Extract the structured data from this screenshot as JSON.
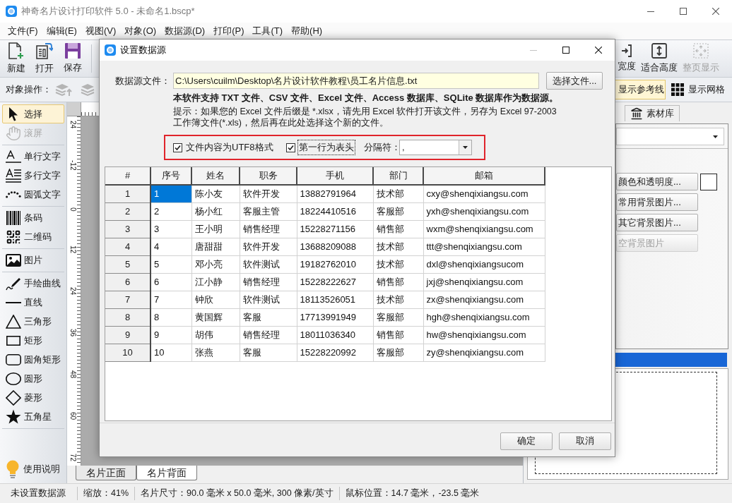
{
  "window": {
    "title": "神奇名片设计打印软件 5.0 - 未命名1.bscp*"
  },
  "menu": [
    "文件(F)",
    "编辑(E)",
    "视图(V)",
    "对象(O)",
    "数据源(D)",
    "打印(P)",
    "工具(T)",
    "帮助(H)"
  ],
  "toolbar": {
    "left": [
      {
        "kind": "new",
        "label": "新建",
        "disabled": false
      },
      {
        "kind": "open",
        "label": "打开",
        "disabled": false
      },
      {
        "kind": "save",
        "label": "保存",
        "disabled": false
      }
    ],
    "right": [
      {
        "kind": "fit_width",
        "label": "宽度",
        "disabled": false
      },
      {
        "kind": "fit_height",
        "label": "适合高度",
        "disabled": false
      },
      {
        "kind": "full_page",
        "label": "整页显示",
        "disabled": true
      }
    ]
  },
  "object_bar": {
    "label": "对象操作：",
    "actions": [
      {
        "kind": "bring_forward",
        "disabled": true
      },
      {
        "kind": "send_backward",
        "disabled": true
      }
    ],
    "toggles": [
      {
        "kind": "guides",
        "label": "显示参考线",
        "selected": true
      },
      {
        "kind": "grid",
        "label": "显示网格",
        "selected": false
      }
    ]
  },
  "tool_groups": [
    {
      "tools": [
        {
          "kind": "select",
          "label": "选择",
          "selected": true,
          "disabled": false
        },
        {
          "kind": "pan",
          "label": "滚屏",
          "selected": false,
          "disabled": true
        }
      ]
    },
    {
      "tools": [
        {
          "kind": "text",
          "label": "单行文字",
          "selected": false,
          "disabled": false
        },
        {
          "kind": "paragraph",
          "label": "多行文字",
          "selected": false,
          "disabled": false
        },
        {
          "kind": "arc_text",
          "label": "圆弧文字",
          "selected": false,
          "disabled": false
        }
      ]
    },
    {
      "tools": [
        {
          "kind": "barcode",
          "label": "条码",
          "selected": false,
          "disabled": false
        },
        {
          "kind": "qrcode",
          "label": "二维码",
          "selected": false,
          "disabled": false
        }
      ]
    },
    {
      "tools": [
        {
          "kind": "image",
          "label": "图片",
          "selected": false,
          "disabled": false
        }
      ]
    },
    {
      "tools": [
        {
          "kind": "freehand",
          "label": "手绘曲线",
          "selected": false,
          "disabled": false
        },
        {
          "kind": "line",
          "label": "直线",
          "selected": false,
          "disabled": false
        },
        {
          "kind": "triangle",
          "label": "三角形",
          "selected": false,
          "disabled": false
        },
        {
          "kind": "rectangle",
          "label": "矩形",
          "selected": false,
          "disabled": false
        },
        {
          "kind": "rounded_rectangle",
          "label": "圆角矩形",
          "selected": false,
          "disabled": false
        },
        {
          "kind": "ellipse",
          "label": "圆形",
          "selected": false,
          "disabled": false
        },
        {
          "kind": "diamond",
          "label": "菱形",
          "selected": false,
          "disabled": false
        },
        {
          "kind": "star",
          "label": "五角星",
          "selected": false,
          "disabled": false
        }
      ]
    }
  ],
  "help": {
    "label": "使用说明"
  },
  "ruler": {
    "labels": [
      "24",
      "-12",
      "0",
      "12",
      "24",
      "36",
      "48",
      "60",
      "72"
    ]
  },
  "page_tabs": [
    {
      "label": "名片正面",
      "selected": true
    },
    {
      "label": "名片背面",
      "selected": false
    }
  ],
  "right_panel": {
    "tabs": [
      {
        "kind": "assets",
        "label": "素材库",
        "selected": false
      }
    ],
    "buttons": [
      {
        "label": "颜色和透明度...",
        "disabled": false
      },
      {
        "label": "常用背景图片...",
        "disabled": false
      },
      {
        "label": "其它背景图片...",
        "disabled": false
      },
      {
        "label": "空背景图片",
        "disabled": true
      }
    ]
  },
  "status_bar": [
    "未设置数据源",
    "缩放：41%",
    "名片尺寸：90.0 毫米 x 50.0 毫米, 300 像素/英寸",
    "鼠标位置：14.7 毫米，-23.5 毫米"
  ],
  "dialog": {
    "title": "设置数据源",
    "controls": [
      {
        "kind": "minimize",
        "disabled": true
      },
      {
        "kind": "maximize",
        "disabled": false
      },
      {
        "kind": "close",
        "disabled": false
      }
    ],
    "file_label": "数据源文件：",
    "file_path": "C:\\Users\\cuilm\\Desktop\\名片设计软件教程\\员工名片信息.txt",
    "browse_button": "选择文件...",
    "support_note": "本软件支持 TXT 文件、CSV 文件、Excel 文件、Access 数据库、SQLite 数据库作为数据源。",
    "hint": "提示：如果您的 Excel 文件后缀是 *.xlsx，请先用 Excel 软件打开该文件，另存为 Excel 97-2003 工作簿文件(*.xls)，然后再在此处选择这个新的文件。",
    "options": [
      {
        "label": "文件内容为UTF8格式",
        "checked": true,
        "focused": false
      },
      {
        "label": "第一行为表头",
        "checked": true,
        "focused": true
      }
    ],
    "separator": {
      "label": "分隔符：",
      "value": ","
    },
    "table": {
      "corner": "#",
      "columns": [
        "序号",
        "姓名",
        "职务",
        "手机",
        "部门",
        "邮箱"
      ],
      "rows": [
        {
          "header": "1",
          "cells": [
            {
              "text": "1",
              "selected": true
            },
            {
              "text": "陈小友",
              "selected": false
            },
            {
              "text": "软件开发",
              "selected": false
            },
            {
              "text": "13882791964",
              "selected": false
            },
            {
              "text": "技术部",
              "selected": false
            },
            {
              "text": "cxy@shenqixiangsu.com",
              "selected": false
            }
          ]
        },
        {
          "header": "2",
          "cells": [
            {
              "text": "2",
              "selected": false
            },
            {
              "text": "杨小红",
              "selected": false
            },
            {
              "text": "客服主管",
              "selected": false
            },
            {
              "text": "18224410516",
              "selected": false
            },
            {
              "text": "客服部",
              "selected": false
            },
            {
              "text": "yxh@shenqixiangsu.com",
              "selected": false
            }
          ]
        },
        {
          "header": "3",
          "cells": [
            {
              "text": "3",
              "selected": false
            },
            {
              "text": "王小明",
              "selected": false
            },
            {
              "text": "销售经理",
              "selected": false
            },
            {
              "text": "15228271156",
              "selected": false
            },
            {
              "text": "销售部",
              "selected": false
            },
            {
              "text": "wxm@shenqixiangsu.com",
              "selected": false
            }
          ]
        },
        {
          "header": "4",
          "cells": [
            {
              "text": "4",
              "selected": false
            },
            {
              "text": "唐甜甜",
              "selected": false
            },
            {
              "text": "软件开发",
              "selected": false
            },
            {
              "text": "13688209088",
              "selected": false
            },
            {
              "text": "技术部",
              "selected": false
            },
            {
              "text": "ttt@shenqixiangsu.com",
              "selected": false
            }
          ]
        },
        {
          "header": "5",
          "cells": [
            {
              "text": "5",
              "selected": false
            },
            {
              "text": "邓小亮",
              "selected": false
            },
            {
              "text": "软件测试",
              "selected": false
            },
            {
              "text": "19182762010",
              "selected": false
            },
            {
              "text": "技术部",
              "selected": false
            },
            {
              "text": "dxl@shenqixiangsucom",
              "selected": false
            }
          ]
        },
        {
          "header": "6",
          "cells": [
            {
              "text": "6",
              "selected": false
            },
            {
              "text": "江小静",
              "selected": false
            },
            {
              "text": "销售经理",
              "selected": false
            },
            {
              "text": "15228222627",
              "selected": false
            },
            {
              "text": "销售部",
              "selected": false
            },
            {
              "text": "jxj@shenqixiangsu.com",
              "selected": false
            }
          ]
        },
        {
          "header": "7",
          "cells": [
            {
              "text": "7",
              "selected": false
            },
            {
              "text": "钟欣",
              "selected": false
            },
            {
              "text": "软件测试",
              "selected": false
            },
            {
              "text": "18113526051",
              "selected": false
            },
            {
              "text": "技术部",
              "selected": false
            },
            {
              "text": "zx@shenqixiangsu.com",
              "selected": false
            }
          ]
        },
        {
          "header": "8",
          "cells": [
            {
              "text": "8",
              "selected": false
            },
            {
              "text": "黄国辉",
              "selected": false
            },
            {
              "text": "客服",
              "selected": false
            },
            {
              "text": "17713991949",
              "selected": false
            },
            {
              "text": "客服部",
              "selected": false
            },
            {
              "text": "hgh@shenqixiangsu.com",
              "selected": false
            }
          ]
        },
        {
          "header": "9",
          "cells": [
            {
              "text": "9",
              "selected": false
            },
            {
              "text": "胡伟",
              "selected": false
            },
            {
              "text": "销售经理",
              "selected": false
            },
            {
              "text": "18011036340",
              "selected": false
            },
            {
              "text": "销售部",
              "selected": false
            },
            {
              "text": "hw@shenqixiangsu.com",
              "selected": false
            }
          ]
        },
        {
          "header": "10",
          "cells": [
            {
              "text": "10",
              "selected": false
            },
            {
              "text": "张燕",
              "selected": false
            },
            {
              "text": "客服",
              "selected": false
            },
            {
              "text": "15228220992",
              "selected": false
            },
            {
              "text": "客服部",
              "selected": false
            },
            {
              "text": "zy@shenqixiangsu.com",
              "selected": false
            }
          ]
        }
      ]
    },
    "buttons": [
      "确定",
      "取消"
    ]
  }
}
